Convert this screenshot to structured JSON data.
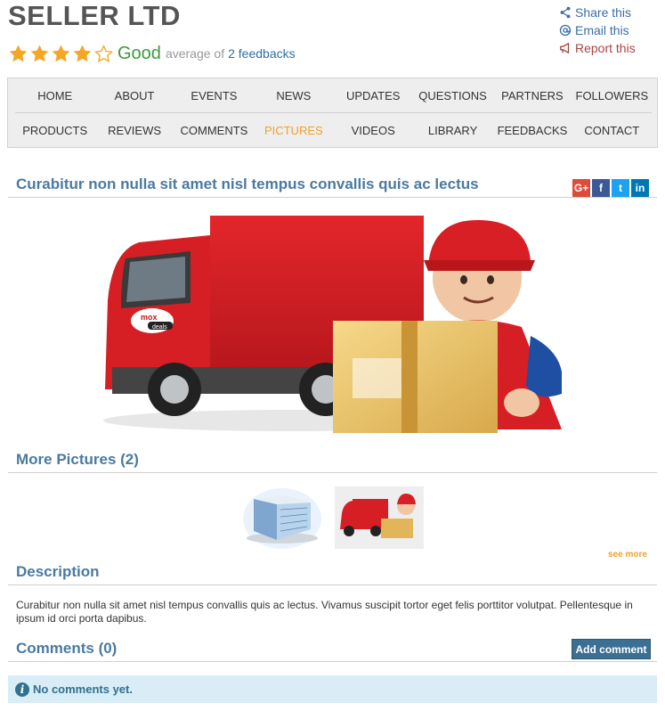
{
  "seller": {
    "name": "SELLER LTD"
  },
  "rating": {
    "stars": 4,
    "max": 5,
    "word": "Good",
    "average_text": "average of",
    "feedback_link": "2 feedbacks"
  },
  "actions": {
    "share": "Share this",
    "email": "Email this",
    "report": "Report this"
  },
  "nav": {
    "row1": [
      "HOME",
      "ABOUT",
      "EVENTS",
      "NEWS",
      "UPDATES",
      "QUESTIONS",
      "PARTNERS",
      "FOLLOWERS"
    ],
    "row2": [
      "PRODUCTS",
      "REVIEWS",
      "COMMENTS",
      "PICTURES",
      "VIDEOS",
      "LIBRARY",
      "FEEDBACKS",
      "CONTACT"
    ],
    "active": "PICTURES"
  },
  "picture": {
    "title": "Curabitur non nulla sit amet nisl tempus convallis quis ac lectus",
    "truck_logo": "mox",
    "truck_logo_sub": "deals"
  },
  "social": [
    {
      "name": "google-plus",
      "glyph": "G+",
      "color": "#dd4b39"
    },
    {
      "name": "facebook",
      "glyph": "f",
      "color": "#3b5998"
    },
    {
      "name": "twitter",
      "glyph": "t",
      "color": "#1da1f2"
    },
    {
      "name": "linkedin",
      "glyph": "in",
      "color": "#0077b5"
    }
  ],
  "more_pictures": {
    "title": "More Pictures (2)",
    "see_more": "see more"
  },
  "description": {
    "title": "Description",
    "text": "Curabitur non nulla sit amet nisl tempus convallis quis ac lectus. Vivamus suscipit tortor eget felis porttitor volutpat. Pellentesque in ipsum id orci porta dapibus."
  },
  "comments": {
    "title": "Comments (0)",
    "add_label": "Add comment",
    "empty_text": "No comments yet."
  },
  "colors": {
    "accent": "#f0a030",
    "heading": "#4a7aa0",
    "star": "#f5a623",
    "info_bg": "#d9edf7"
  }
}
